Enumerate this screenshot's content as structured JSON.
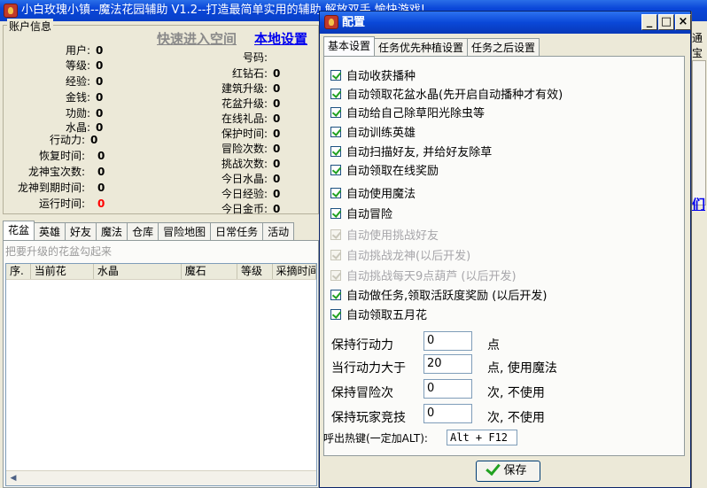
{
  "main": {
    "title": "小白玫瑰小镇--魔法花园辅助  V1.2--打造最简单实用的辅助,解放双手,愉快游戏!",
    "account": {
      "group_title": "账户信息",
      "link_space": "快速进入空间",
      "link_local": "本地设置",
      "left_fields": [
        {
          "label": "用户:",
          "value": "0"
        },
        {
          "label": "等级:",
          "value": "0"
        },
        {
          "label": "经验:",
          "value": "0"
        },
        {
          "label": "金钱:",
          "value": "0"
        },
        {
          "label": "功勋:",
          "value": "0"
        },
        {
          "label": "水晶:",
          "value": "0"
        },
        {
          "label": "行动力:",
          "value": "0"
        },
        {
          "label": "恢复时间:",
          "value": "0"
        },
        {
          "label": "龙神宝次数:",
          "value": "0"
        },
        {
          "label": "龙神到期时间:",
          "value": "0"
        },
        {
          "label": "运行时间:",
          "value": "0"
        }
      ],
      "right_fields": [
        {
          "label": "号码:",
          "value": ""
        },
        {
          "label": "红钻石:",
          "value": "0"
        },
        {
          "label": "建筑升级:",
          "value": "0"
        },
        {
          "label": "花盆升级:",
          "value": "0"
        },
        {
          "label": "在线礼品:",
          "value": "0"
        },
        {
          "label": "保护时间:",
          "value": "0"
        },
        {
          "label": "冒险次数:",
          "value": "0"
        },
        {
          "label": "挑战次数:",
          "value": "0"
        },
        {
          "label": "今日水晶:",
          "value": "0"
        },
        {
          "label": "今日经验:",
          "value": "0"
        },
        {
          "label": "今日金币:",
          "value": "0"
        }
      ],
      "runtime_color": "#ff0000"
    },
    "tabs": [
      "花盆",
      "英雄",
      "好友",
      "魔法",
      "仓库",
      "冒险地图",
      "日常任务",
      "活动"
    ],
    "hint": "把要升级的花盆勾起来",
    "table_headers": [
      "序.",
      "当前花",
      "水晶",
      "魔石",
      "等级",
      "采摘时间"
    ],
    "right_fragment_1": "通宝",
    "right_fragment_2": "们"
  },
  "dialog": {
    "title": "配置",
    "buttons": {
      "minimize": "_",
      "maximize": "□",
      "close": "×"
    },
    "tabs": [
      "基本设置",
      "任务优先种植设置",
      "任务之后设置"
    ],
    "checkboxes": [
      {
        "label": "自动收获播种",
        "checked": true,
        "disabled": false
      },
      {
        "label": "自动领取花盆水晶(先开启自动播种才有效)",
        "checked": true,
        "disabled": false
      },
      {
        "label": "自动给自己除草阳光除虫等",
        "checked": true,
        "disabled": false
      },
      {
        "label": "自动训练英雄",
        "checked": true,
        "disabled": false
      },
      {
        "label": "自动扫描好友, 并给好友除草",
        "checked": true,
        "disabled": false
      },
      {
        "label": "自动领取在线奖励",
        "checked": true,
        "disabled": false
      },
      {
        "label": "自动使用魔法",
        "checked": true,
        "disabled": false
      },
      {
        "label": "自动冒险",
        "checked": true,
        "disabled": false
      },
      {
        "label": "自动使用挑战好友",
        "checked": true,
        "disabled": true
      },
      {
        "label": "自动挑战龙神(以后开发)",
        "checked": true,
        "disabled": true
      },
      {
        "label": "自动挑战每天9点葫芦 (以后开发)",
        "checked": true,
        "disabled": true
      },
      {
        "label": "自动做任务,领取活跃度奖励 (以后开发)",
        "checked": true,
        "disabled": false
      },
      {
        "label": "自动领取五月花",
        "checked": true,
        "disabled": false
      }
    ],
    "settings": [
      {
        "label": "保持行动力",
        "value": "0",
        "unit": "点"
      },
      {
        "label": "当行动力大于",
        "value": "20",
        "unit": "点, 使用魔法"
      },
      {
        "label": "保持冒险次",
        "value": "0",
        "unit": "次, 不使用"
      },
      {
        "label": "保持玩家竞技",
        "value": "0",
        "unit": "次, 不使用"
      }
    ],
    "hotkey_label": "呼出热键(一定加ALT):",
    "hotkey_value": "Alt + F12",
    "save_label": "保存"
  }
}
